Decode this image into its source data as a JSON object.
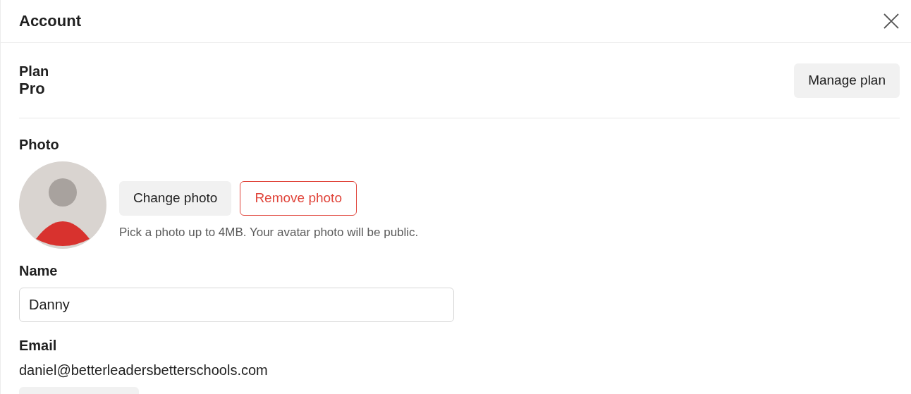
{
  "dialog": {
    "title": "Account"
  },
  "plan": {
    "label": "Plan",
    "value": "Pro",
    "button": "Manage plan"
  },
  "photo": {
    "label": "Photo",
    "change_button": "Change photo",
    "remove_button": "Remove photo",
    "hint": "Pick a photo up to 4MB. Your avatar photo will be public."
  },
  "name": {
    "label": "Name",
    "value": "Danny"
  },
  "email": {
    "label": "Email",
    "value": "daniel@betterleadersbetterschools.com"
  }
}
